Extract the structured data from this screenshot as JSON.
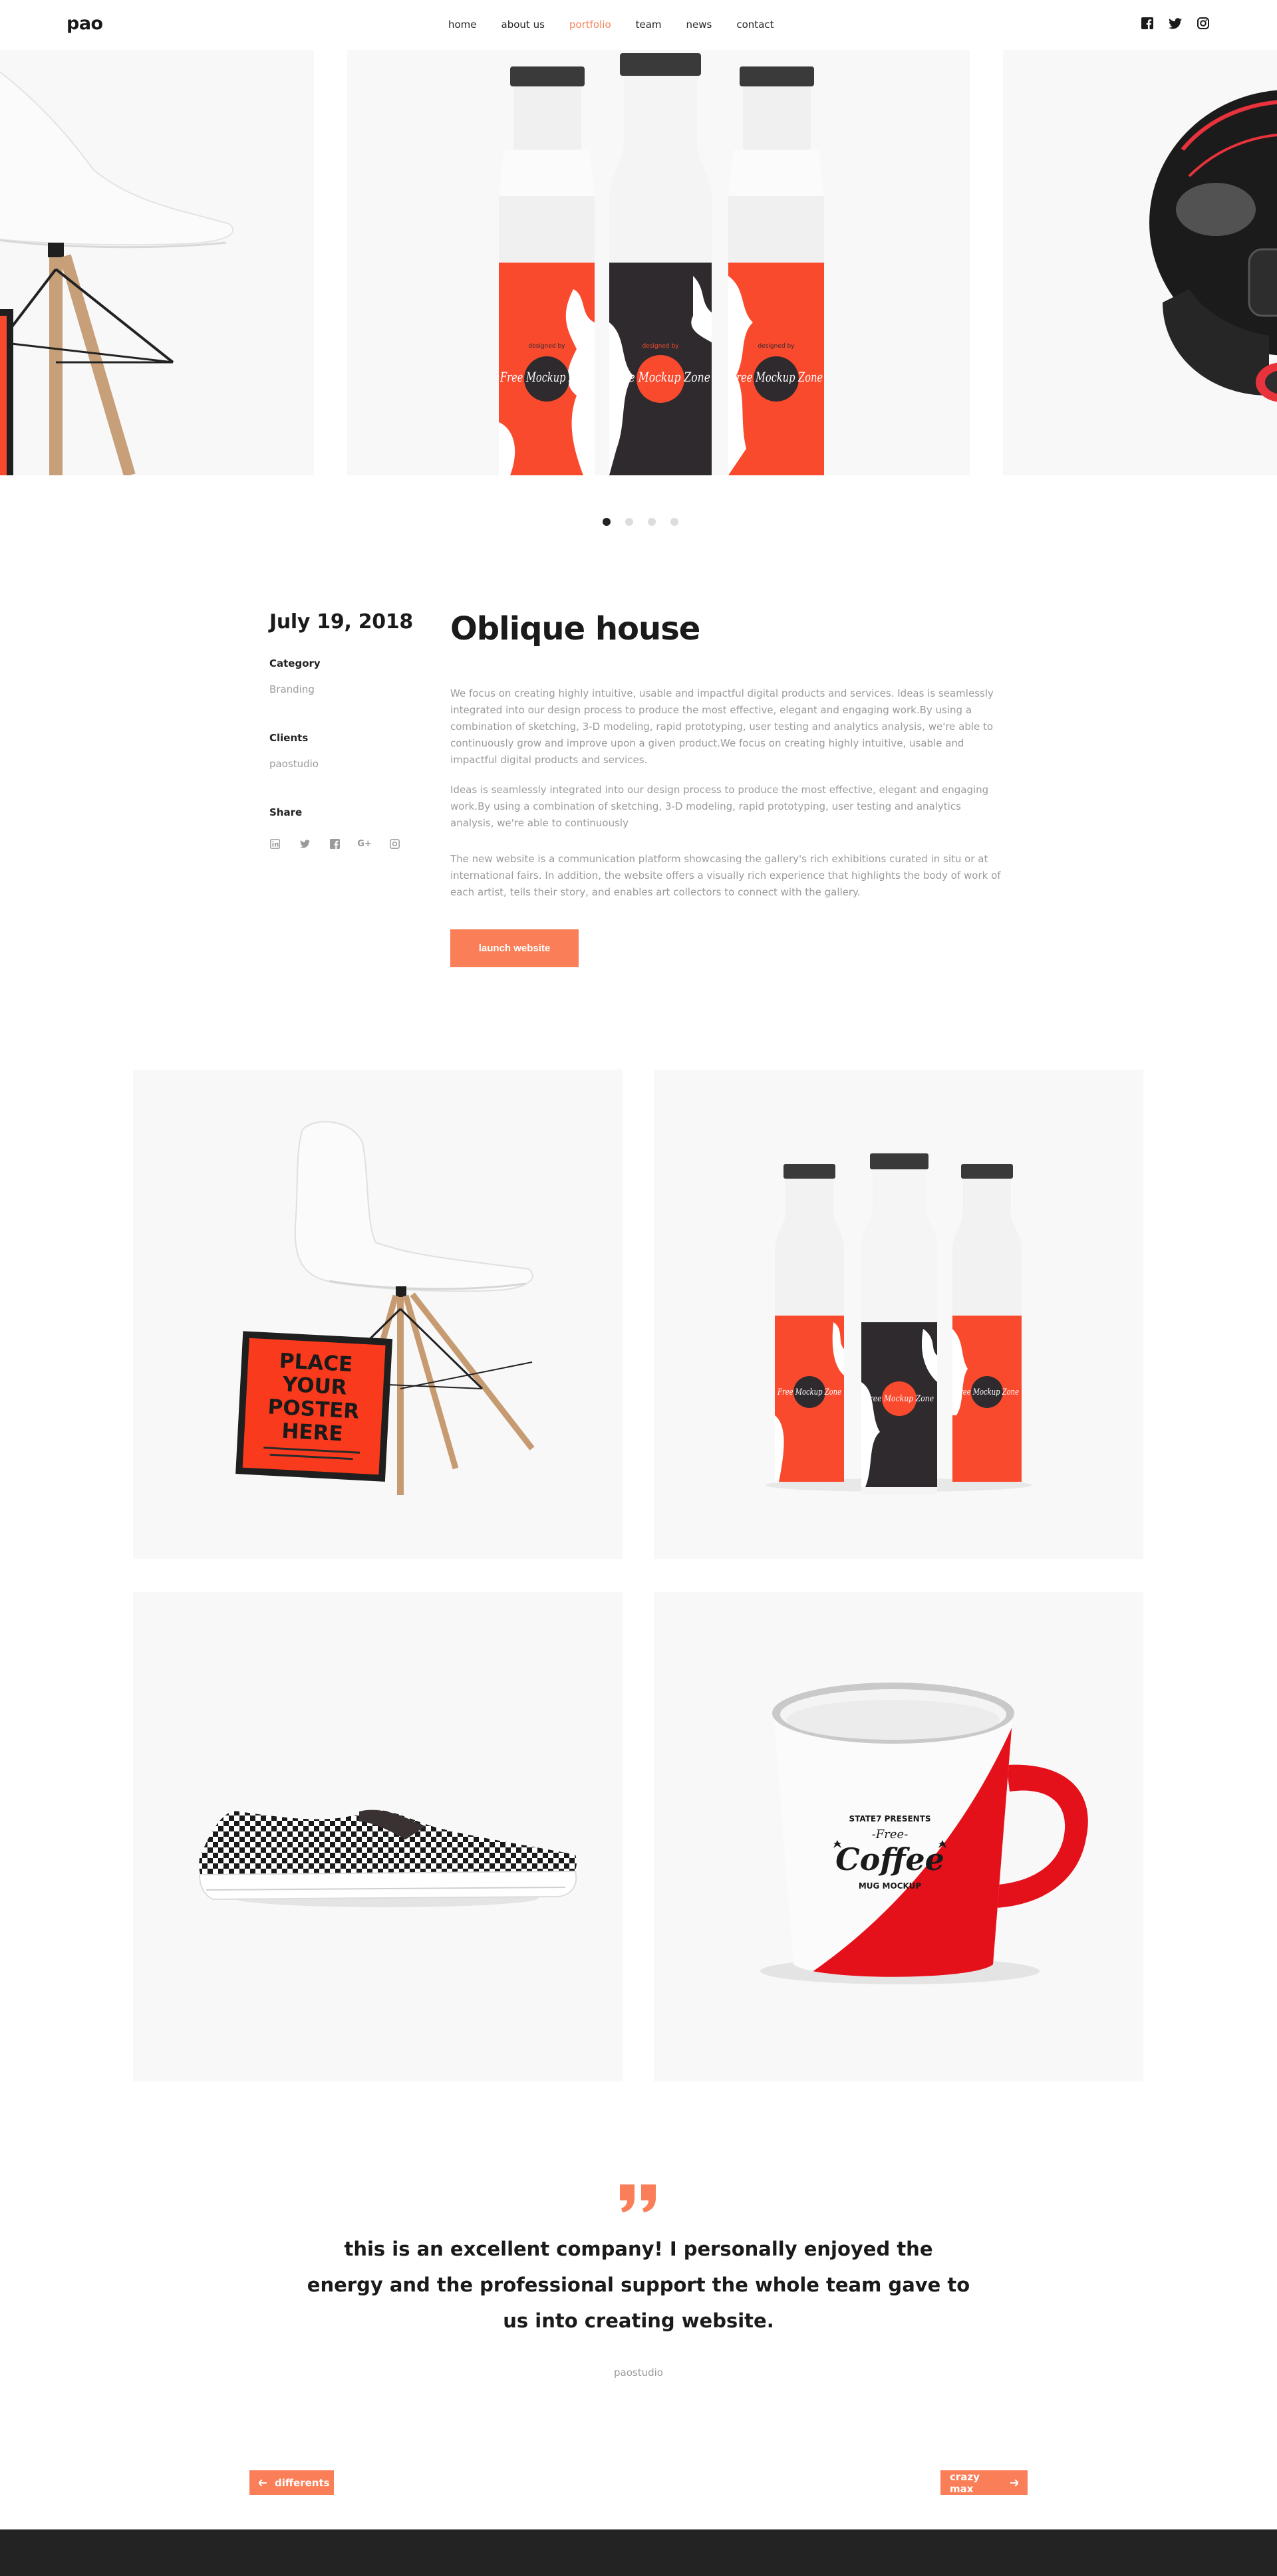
{
  "header": {
    "logo": "pao",
    "nav": [
      "home",
      "about us",
      "portfolio",
      "team",
      "news",
      "contact"
    ],
    "active_nav": "portfolio",
    "social": [
      "facebook-icon",
      "twitter-icon",
      "instagram-icon"
    ]
  },
  "carousel": {
    "slides": [
      "chair",
      "milk-bottles",
      "helmet"
    ],
    "active_dot": 0,
    "dot_count": 4,
    "bottle_label_small": "designed by",
    "bottle_label_brand": "Free Mockup Zone"
  },
  "project": {
    "date": "July 19, 2018",
    "category_label": "Category",
    "category_value": "Branding",
    "clients_label": "Clients",
    "clients_value": "paostudio",
    "share_label": "Share",
    "share_icons": [
      "linkedin-icon",
      "twitter-icon",
      "facebook-icon",
      "google-plus-icon",
      "instagram-icon"
    ],
    "title": "Oblique house",
    "paragraph1": "We focus on creating highly intuitive, usable and impactful digital products and services. Ideas is seamlessly integrated into our design process to produce the most effective, elegant and engaging work.By using a combination of sketching, 3-D modeling, rapid prototyping, user testing and analytics analysis, we're able to continuously grow and improve upon a given product.We focus on creating highly intuitive, usable and impactful digital products and services.",
    "paragraph2": "Ideas is seamlessly integrated into our design process to produce the most effective, elegant and engaging work.By using a combination of sketching, 3-D modeling, rapid prototyping, user testing and analytics analysis, we're able to continuously",
    "paragraph3": "The new website is a communication platform showcasing the gallery's rich exhibitions curated in situ or at international fairs. In addition, the website offers a visually rich experience that highlights the body of work of each artist, tells their story, and enables art collectors to connect with the gallery.",
    "launch_label": "launch website"
  },
  "gallery": {
    "poster_line1": "PLACE",
    "poster_line2": "YOUR",
    "poster_line3": "POSTER",
    "poster_line4": "HERE",
    "mug_top": "STATE7 PRESENTS",
    "mug_free": "-Free-",
    "mug_main": "Coffee",
    "mug_bottom": "MUG MOCKUP"
  },
  "testimonial": {
    "text": "this is an excellent company! I personally enjoyed the energy and the professional support the whole team gave to us into creating website.",
    "author": "paostudio"
  },
  "pager": {
    "prev_label": "differents",
    "next_label": "crazy max"
  },
  "colors": {
    "accent": "#fa7f58",
    "dark": "#1a1a1a",
    "muted": "#9a9a9a",
    "tile_bg": "#f8f8f8",
    "bottle_red": "#fa4a2e",
    "bottle_dark": "#2e2a2e",
    "mug_red": "#e4111b"
  }
}
